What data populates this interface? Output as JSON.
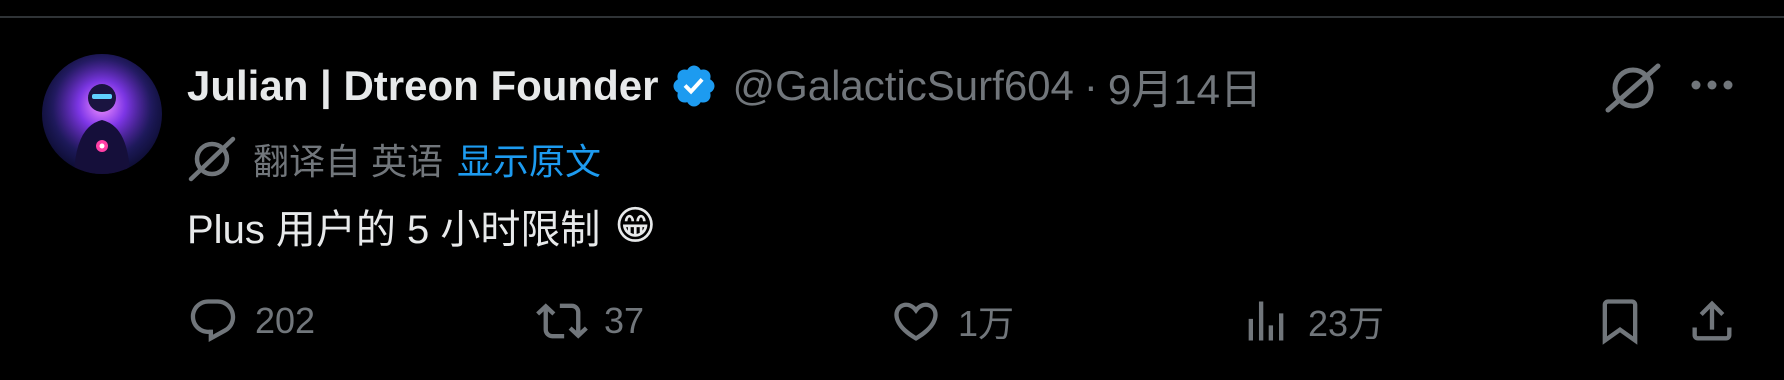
{
  "tweet": {
    "display_name": "Julian | Dtreon Founder",
    "handle": "@GalacticSurf604",
    "separator": "·",
    "date": "9月14日",
    "translated_from": "翻译自 英语",
    "show_original": "显示原文",
    "text": "Plus 用户的 5 小时限制",
    "emoji": "😁"
  },
  "actions": {
    "replies": "202",
    "retweets": "37",
    "likes": "1万",
    "views": "23万"
  },
  "icons": {
    "verified": "verified-badge-icon",
    "grok": "grok-icon",
    "more": "more-icon",
    "translate": "grok-icon",
    "reply": "reply-icon",
    "retweet": "retweet-icon",
    "like": "heart-icon",
    "views": "views-icon",
    "bookmark": "bookmark-icon",
    "share": "share-icon"
  },
  "colors": {
    "background": "#000000",
    "primary_text": "#e7e9ea",
    "secondary_text": "#71767b",
    "link": "#1d9bf0",
    "verified": "#1d9bf0"
  }
}
